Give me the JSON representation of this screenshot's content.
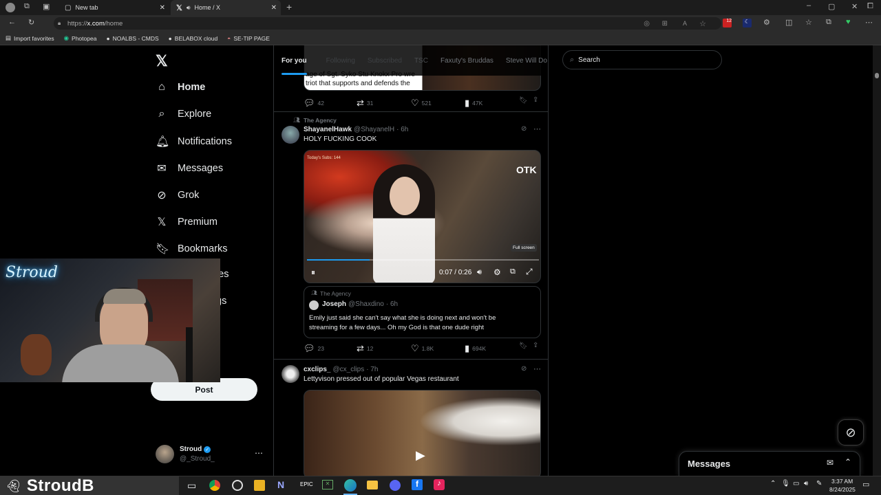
{
  "browser": {
    "tabs": [
      {
        "title": "New tab"
      },
      {
        "title": "Home / X"
      }
    ],
    "url_prefix": "https://",
    "url_host": "x.com",
    "url_path": "/home",
    "bookmarks": [
      "Import favorites",
      "Photopea",
      "NOALBS - CMDS",
      "BELABOX cloud",
      "SE-TIP PAGE"
    ]
  },
  "sidebar": {
    "items": [
      {
        "label": "Home",
        "icon": "home-icon"
      },
      {
        "label": "Explore",
        "icon": "search-icon"
      },
      {
        "label": "Notifications",
        "icon": "bell-icon"
      },
      {
        "label": "Messages",
        "icon": "mail-icon"
      },
      {
        "label": "Grok",
        "icon": "grok-icon"
      },
      {
        "label": "Premium",
        "icon": "x-logo-icon"
      },
      {
        "label": "Bookmarks",
        "icon": "bookmark-icon"
      },
      {
        "label": "ies",
        "icon": "communities-icon"
      },
      {
        "label": "gs",
        "icon": "settings-icon"
      }
    ],
    "post_label": "Post",
    "profile": {
      "name": "Stroud",
      "handle": "@_Stroud_"
    }
  },
  "feed": {
    "tabs": [
      "For you",
      "Following",
      "Subscribed",
      "TSC",
      "Faxuty's Bruddas",
      "Steve Will Do"
    ],
    "top_post": {
      "caption_line1": "age of Sgt. Syko Stu Knokx Pro wre",
      "caption_line2": "triot that supports and defends the",
      "replies": "42",
      "reposts": "31",
      "likes": "521",
      "views": "47K"
    },
    "post1": {
      "community": "The Agency",
      "name": "ShayanelHawk",
      "handle": "@ShayanelH",
      "time": "· 6h",
      "text": "HOLY FUCKING COOK",
      "video_time": "0:07 / 0:26",
      "fullscreen_tip": "Full screen",
      "overlay_subs": "Today's Subs: 144",
      "quote": {
        "community": "The Agency",
        "name": "Joseph",
        "handle": "@Shaxdino",
        "time": "· 6h",
        "text_line1": "Emily just said she can't say what she is doing next and won't be",
        "text_line2": "streaming for a few days... Oh my God is that one dude right"
      },
      "replies": "23",
      "reposts": "12",
      "likes": "1.8K",
      "views": "694K"
    },
    "post2": {
      "name": "cxclips_",
      "handle": "@cx_clips",
      "time": "· 7h",
      "text": "Lettyvison pressed out of popular Vegas restaurant"
    }
  },
  "right": {
    "search_placeholder": "Search"
  },
  "messages_dock": {
    "label": "Messages"
  },
  "webcam": {
    "sign": "Stroud"
  },
  "taskbar": {
    "stream_label": "StroudB",
    "time": "3:37 AM",
    "date": "8/24/2025"
  },
  "colors": {
    "accent": "#1d9bf0",
    "bg": "#000000",
    "border": "#2f3336"
  }
}
